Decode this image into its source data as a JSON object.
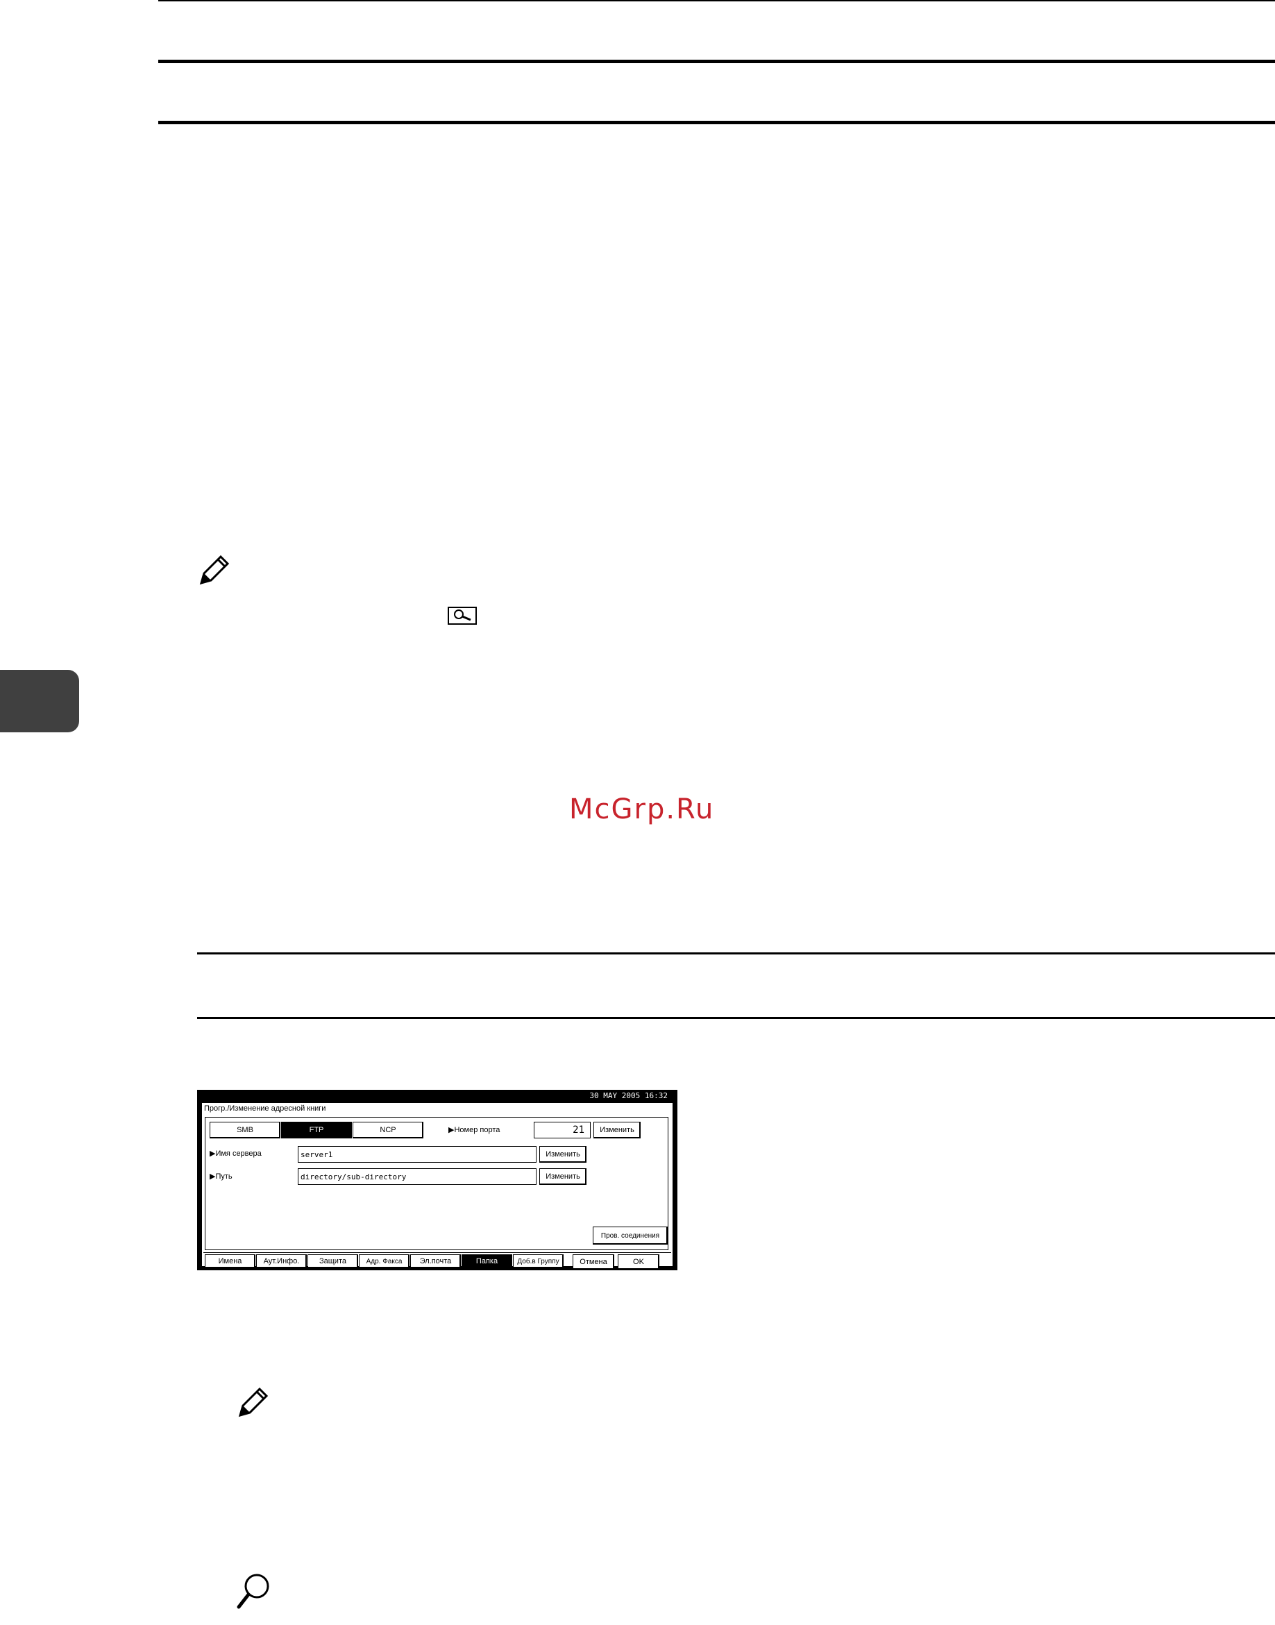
{
  "watermark": "McGrp.Ru",
  "panel": {
    "datetime": "30 MAY  2005 16:32",
    "title": "Прогр./Изменение адресной книги",
    "protocols": [
      "SMB",
      "FTP",
      "NCP"
    ],
    "selected_protocol": "FTP",
    "port_label": "▶Номер порта",
    "port_value": "21",
    "change_label": "Изменить",
    "server_label": "▶Имя сервера",
    "server_value": "server1",
    "path_label": "▶Путь",
    "path_value": "directory/sub-directory",
    "connection_test_label": "Пров. соединения",
    "tabs": [
      "Имена",
      "Аут.Инфо.",
      "Защита",
      "Адр. Факса",
      "Эл.почта",
      "Папка",
      "Доб.в Группу"
    ],
    "selected_tab": "Папка",
    "cancel_label": "Отмена",
    "ok_label": "OK"
  }
}
